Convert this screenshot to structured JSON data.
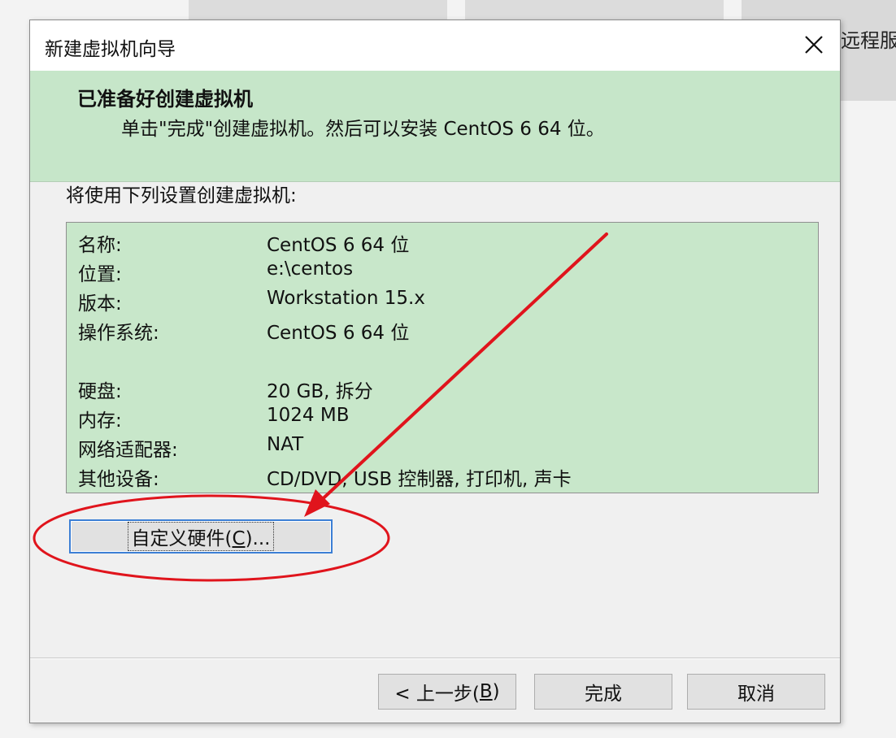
{
  "background": {
    "partial_window_text": "远程服"
  },
  "dialog": {
    "title": "新建虚拟机向导",
    "header_title": "已准备好创建虚拟机",
    "header_subtitle": "单击\"完成\"创建虚拟机。然后可以安装 CentOS 6 64 位。",
    "intro": "将使用下列设置创建虚拟机:",
    "settings": [
      {
        "key": "名称:",
        "value": "CentOS 6 64 位"
      },
      {
        "key": "位置:",
        "value": "e:\\centos"
      },
      {
        "key": "版本:",
        "value": "Workstation 15.x"
      },
      {
        "key": "操作系统:",
        "value": "CentOS 6 64 位"
      },
      {
        "key": "硬盘:",
        "value": "20 GB, 拆分"
      },
      {
        "key": "内存:",
        "value": "1024 MB"
      },
      {
        "key": "网络适配器:",
        "value": "NAT"
      },
      {
        "key": "其他设备:",
        "value": "CD/DVD, USB 控制器, 打印机, 声卡"
      }
    ],
    "customize_button": {
      "prefix": "自定义硬件(",
      "accel": "C",
      "suffix": ")..."
    },
    "back_button": {
      "prefix": "< 上一步(",
      "accel": "B",
      "suffix": ")"
    },
    "finish_button": "完成",
    "cancel_button": "取消"
  },
  "colors": {
    "header_green": "#c6e6c9",
    "settings_green": "#c8e7ca",
    "annotation_red": "#e0141c",
    "focus_blue": "#3c7fd5"
  },
  "icons": {
    "close": "close-icon"
  }
}
